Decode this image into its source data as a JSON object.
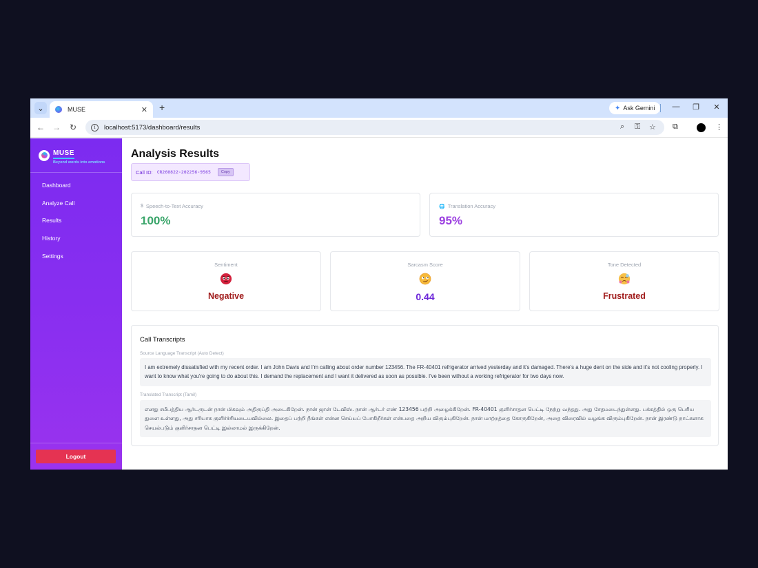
{
  "browser": {
    "tab_title": "MUSE",
    "url": "localhost:5173/dashboard/results",
    "ask_gemini": "Ask Gemini"
  },
  "app": {
    "name": "MUSE",
    "tagline": "Beyond words into emotions",
    "nav": [
      "Dashboard",
      "Analyze Call",
      "Results",
      "History",
      "Settings"
    ],
    "logout": "Logout"
  },
  "page": {
    "title": "Analysis Results",
    "call_id_label": "Call ID:",
    "call_id": "CR260822-202256-9565",
    "copy": "Copy"
  },
  "accuracy": {
    "stt_label": "Speech-to-Text Accuracy",
    "stt_value": "100%",
    "translation_label": "Translation Accuracy",
    "translation_value": "95%"
  },
  "metrics": {
    "sentiment_label": "Sentiment",
    "sentiment_value": "Negative",
    "sarcasm_label": "Sarcasm Score",
    "sarcasm_value": "0.44",
    "tone_label": "Tone Detected",
    "tone_value": "Frustrated"
  },
  "transcripts": {
    "title": "Call Transcripts",
    "source_label": "Source Language Transcript (Auto Detect)",
    "source_text": "I am extremely dissatisfied with my recent order. I am John Davis and I'm calling about order number 123456. The FR-40401 refrigerator arrived yesterday and it's damaged. There's a huge dent on the side and it's not cooling properly. I want to know what you're going to do about this. I demand the replacement and I want it delivered as soon as possible. I've been without a working refrigerator for two days now.",
    "translated_label": "Translated Transcript (Tamil)",
    "translated_text": "எனது சமீபத்திய ஆர்டருடன் நான் மிகவும் அதிருப்தி அடைகிறேன். நான் ஜான் டேவிஸ். நான் ஆர்டர் எண் 123456 பற்றி அழைக்கிறேன். FR-40401 குளிர்சாதன பெட்டி நேற்று வந்தது. அது சேதமடைந்துள்ளது. பக்கத்தில் ஒரு பெரிய துளை உள்ளது, அது சரியாக குளிர்ச்சியடையவில்லை. இதைப் பற்றி நீங்கள் என்ன செய்யப் போகிறீர்கள் என்பதை அறிய விரும்புகிறேன். நான் மாற்றத்தை கோருகிறேன், அதை விரைவில் வழங்க விரும்புகிறேன். நான் இரண்டு நாட்களாக செயல்படும் குளிர்சாதன பெட்டி இல்லாமல் இருக்கிறேன்."
  },
  "colors": {
    "sidebar": "#8b2ff0",
    "stt_green": "#3aa56a",
    "translation_purple": "#9b3fe0",
    "negative_red": "#a01b1b",
    "sarcasm_purple": "#6d28d9",
    "logout_red": "#e53352"
  }
}
